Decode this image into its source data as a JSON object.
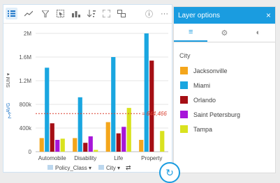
{
  "toolbar": {
    "icons": [
      "legend-icon",
      "trend-icon",
      "filter-icon",
      "select-icon",
      "chart-type-icon",
      "sort-icon",
      "expand-icon",
      "flip-card-icon",
      "info-icon",
      "more-icon"
    ],
    "more_label": "···",
    "info_label": "ⓘ"
  },
  "chart": {
    "y_axis_label": "SUM ▾",
    "y_axis_prefix": "∑",
    "avg_label": "AVG",
    "avg_value_label": "= 644,466",
    "x_field_label": "Policy_Class ▾",
    "color_field_label": "City ▾",
    "swap_label": "⇄"
  },
  "chart_data": {
    "type": "bar",
    "categories": [
      "Automobile",
      "Disability",
      "Life",
      "Property"
    ],
    "series": [
      {
        "name": "Jacksonville",
        "values": [
          230000,
          230000,
          500000,
          200000
        ]
      },
      {
        "name": "Miami",
        "values": [
          1420000,
          920000,
          1600000,
          2000000
        ]
      },
      {
        "name": "Orlando",
        "values": [
          480000,
          150000,
          310000,
          1540000
        ]
      },
      {
        "name": "Saint Petersburg",
        "values": [
          200000,
          260000,
          420000,
          0
        ]
      },
      {
        "name": "Tampa",
        "values": [
          220000,
          30000,
          740000,
          350000
        ]
      }
    ],
    "y_ticks": [
      "0",
      "400k",
      "800k",
      "1.2M",
      "1.6M",
      "2M"
    ],
    "ylim": [
      0,
      2000000
    ],
    "average": 644466,
    "colors": [
      "#f4a61c",
      "#1aa6e0",
      "#a50f15",
      "#a716d9",
      "#d9e21f"
    ]
  },
  "panel": {
    "title": "Layer options",
    "close_label": "×",
    "tabs": [
      "≡",
      "⚙",
      "◐"
    ],
    "section_label": "City",
    "legend": [
      {
        "label": "Jacksonville",
        "color": "#f4a61c"
      },
      {
        "label": "Miami",
        "color": "#1aa6e0"
      },
      {
        "label": "Orlando",
        "color": "#a50f15"
      },
      {
        "label": "Saint Petersburg",
        "color": "#a716d9"
      },
      {
        "label": "Tampa",
        "color": "#d9e21f"
      }
    ]
  }
}
